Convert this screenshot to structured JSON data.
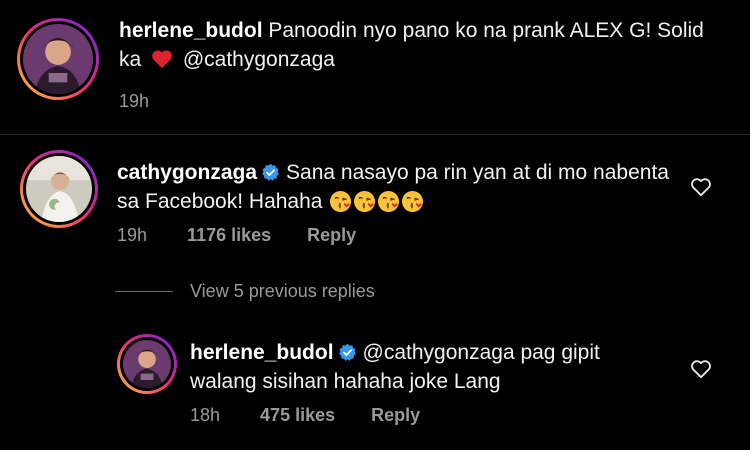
{
  "post_caption": {
    "username": "herlene_budol",
    "text_before_emoji": " Panoodin nyo pano ko na prank ALEX G! Solid ka ",
    "mention": " @cathygonzaga",
    "time": "19h"
  },
  "comment": {
    "username": "cathygonzaga",
    "text": "Sana nasayo pa rin yan at di mo nabenta sa Facebook! Hahaha ",
    "time": "19h",
    "likes": "1176 likes",
    "reply_label": "Reply"
  },
  "view_replies": {
    "label": "View 5 previous replies"
  },
  "reply": {
    "username": "herlene_budol",
    "text": "@cathygonzaga pag gipit walang sisihan hahaha joke Lang",
    "time": "18h",
    "likes": "475 likes",
    "reply_label": "Reply"
  },
  "colors": {
    "background": "#000000",
    "secondary_text": "#9a9a9a",
    "verified_blue": "#3897f0",
    "story_ring": "#d6249f"
  },
  "icons": [
    "heart-emoji",
    "verified-badge-icon",
    "kissing-face-emoji",
    "heart-outline-icon"
  ]
}
